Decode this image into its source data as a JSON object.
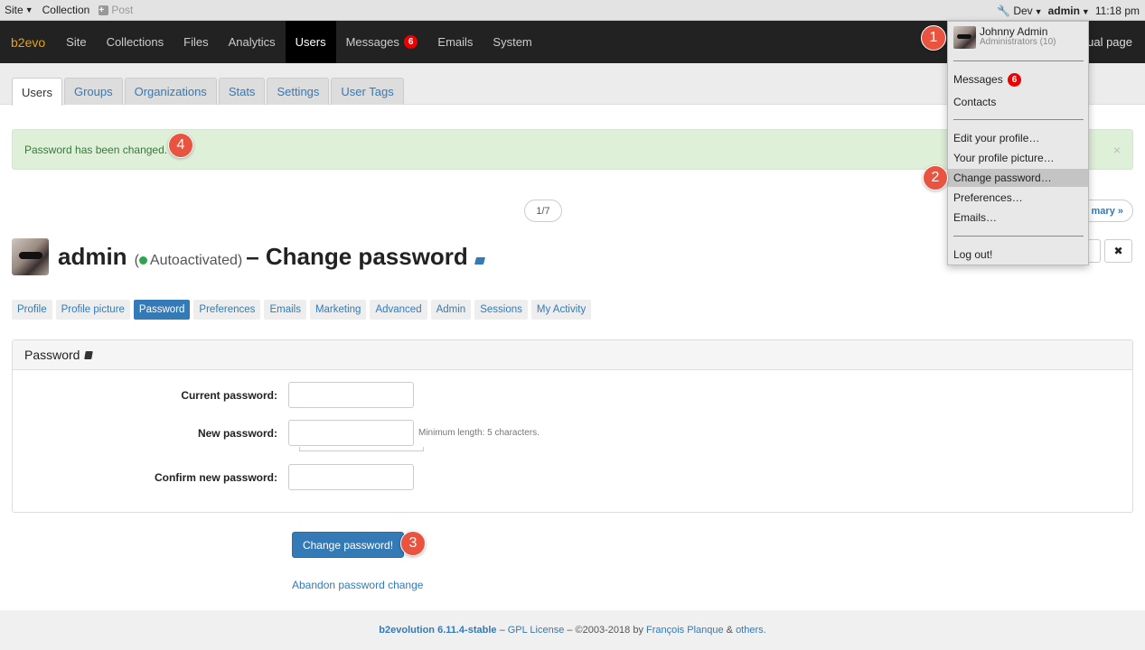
{
  "sysbar": {
    "site": "Site",
    "collection": "Collection",
    "post": "Post",
    "dev": "Dev",
    "user": "admin",
    "time": "11:18 pm"
  },
  "mainnav": {
    "brand": "b2evo",
    "items": [
      "Site",
      "Collections",
      "Files",
      "Analytics",
      "Users",
      "Messages",
      "Emails",
      "System"
    ],
    "messages_count": "6",
    "manual": "nual page"
  },
  "tabs": [
    "Users",
    "Groups",
    "Organizations",
    "Stats",
    "Settings",
    "User Tags"
  ],
  "alert": {
    "text": "Password has been changed.",
    "close": "×"
  },
  "pager": {
    "text": "1/7",
    "summary": "mary »"
  },
  "heading": {
    "username": "admin",
    "status": "Autoactivated)",
    "status_open": "(",
    "title": "– Change password",
    "close": "✖"
  },
  "subtabs": [
    "Profile",
    "Profile picture",
    "Password",
    "Preferences",
    "Emails",
    "Marketing",
    "Advanced",
    "Admin",
    "Sessions",
    "My Activity"
  ],
  "panel": {
    "title": "Password",
    "current_label": "Current password:",
    "new_label": "New password:",
    "new_hint": "Minimum length: 5 characters.",
    "confirm_label": "Confirm new password:"
  },
  "submit": "Change password!",
  "abandon": "Abandon password change",
  "footer": {
    "product": "b2evolution 6.11.4-stable",
    "sep1": " – ",
    "license": "GPL License",
    "copy": " – ©2003-2018 by ",
    "author": "François Planque",
    "amp": " & ",
    "others": "others."
  },
  "dropdown": {
    "name": "Johnny Admin",
    "group": "Administrators (10)",
    "messages": "Messages",
    "messages_count": "6",
    "contacts": "Contacts",
    "edit_profile": "Edit your profile…",
    "profile_picture": "Your profile picture…",
    "change_password": "Change password…",
    "preferences": "Preferences…",
    "emails": "Emails…",
    "logout": "Log out!"
  },
  "callouts": [
    "1",
    "2",
    "3",
    "4"
  ]
}
